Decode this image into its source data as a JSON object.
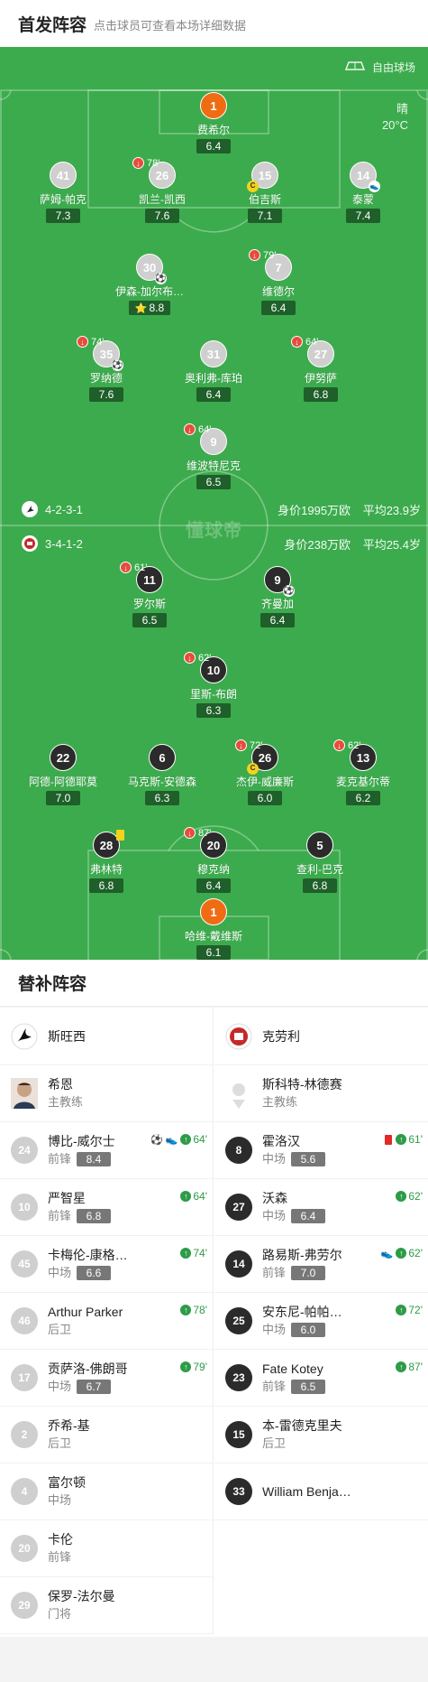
{
  "header": {
    "title": "首发阵容",
    "subtitle": "点击球员可查看本场详细数据"
  },
  "pitch": {
    "free_label": "自由球场",
    "weather": "晴",
    "temperature": "20°C",
    "watermark": "懂球帝",
    "home": {
      "formation": "4-2-3-1",
      "value": "身价1995万欧",
      "age": "平均23.9岁"
    },
    "away": {
      "formation": "3-4-1-2",
      "value": "身价238万欧",
      "age": "平均25.4岁"
    }
  },
  "home_players": [
    {
      "num": "1",
      "name": "费希尔",
      "rating": "6.4",
      "gk": true
    },
    {
      "num": "41",
      "name": "萨姆-帕克",
      "rating": "7.3"
    },
    {
      "num": "26",
      "name": "凯兰-凯西",
      "rating": "7.6",
      "sub": "78'"
    },
    {
      "num": "15",
      "name": "伯吉斯",
      "rating": "7.1",
      "cap": "C"
    },
    {
      "num": "14",
      "name": "泰蒙",
      "rating": "7.4",
      "assist": true
    },
    {
      "num": "30",
      "name": "伊森-加尔布…",
      "rating": "8.8",
      "ball": true,
      "star": true
    },
    {
      "num": "7",
      "name": "维德尔",
      "rating": "6.4",
      "sub": "79'"
    },
    {
      "num": "35",
      "name": "罗纳德",
      "rating": "7.6",
      "sub": "74'",
      "ball": true
    },
    {
      "num": "31",
      "name": "奥利弗-库珀",
      "rating": "6.4"
    },
    {
      "num": "27",
      "name": "伊努萨",
      "rating": "6.8",
      "sub": "64'"
    },
    {
      "num": "9",
      "name": "维波特尼克",
      "rating": "6.5",
      "sub": "64'"
    }
  ],
  "away_players": [
    {
      "num": "11",
      "name": "罗尔斯",
      "rating": "6.5",
      "sub": "61'"
    },
    {
      "num": "9",
      "name": "齐曼加",
      "rating": "6.4",
      "ball": true
    },
    {
      "num": "10",
      "name": "里斯-布朗",
      "rating": "6.3",
      "sub": "62'"
    },
    {
      "num": "22",
      "name": "阿德-阿德耶莫",
      "rating": "7.0"
    },
    {
      "num": "6",
      "name": "马克斯-安德森",
      "rating": "6.3"
    },
    {
      "num": "26",
      "name": "杰伊-威廉斯",
      "rating": "6.0",
      "sub": "72'",
      "cap": "C"
    },
    {
      "num": "13",
      "name": "麦克基尔蒂",
      "rating": "6.2",
      "sub": "62'"
    },
    {
      "num": "28",
      "name": "弗林特",
      "rating": "6.8",
      "yellow": true
    },
    {
      "num": "20",
      "name": "穆克纳",
      "rating": "6.4",
      "sub": "87'"
    },
    {
      "num": "5",
      "name": "查利-巴克",
      "rating": "6.8"
    },
    {
      "num": "1",
      "name": "哈维-戴维斯",
      "rating": "6.1",
      "gk": true
    }
  ],
  "subs": {
    "title": "替补阵容",
    "home_team": "斯旺西",
    "away_team": "克劳利",
    "home_coach": {
      "name": "希恩",
      "role": "主教练"
    },
    "away_coach": {
      "name": "斯科特-林德赛",
      "role": "主教练"
    },
    "home": [
      {
        "num": "24",
        "name": "博比-威尔士",
        "pos": "前锋",
        "rating": "8.4",
        "time": "64'",
        "goal": true,
        "assist": true
      },
      {
        "num": "10",
        "name": "严智星",
        "pos": "前锋",
        "rating": "6.8",
        "time": "64'"
      },
      {
        "num": "45",
        "name": "卡梅伦-康格…",
        "pos": "中场",
        "rating": "6.6",
        "time": "74'"
      },
      {
        "num": "46",
        "name": "Arthur Parker",
        "pos": "后卫",
        "rating": "",
        "time": "78'"
      },
      {
        "num": "17",
        "name": "贡萨洛-佛朗哥",
        "pos": "中场",
        "rating": "6.7",
        "time": "79'"
      },
      {
        "num": "2",
        "name": "乔希-基",
        "pos": "后卫",
        "rating": ""
      },
      {
        "num": "4",
        "name": "富尔顿",
        "pos": "中场",
        "rating": ""
      },
      {
        "num": "20",
        "name": "卡伦",
        "pos": "前锋",
        "rating": ""
      },
      {
        "num": "29",
        "name": "保罗-法尔曼",
        "pos": "门将",
        "rating": ""
      }
    ],
    "away": [
      {
        "num": "8",
        "name": "霍洛汉",
        "pos": "中场",
        "rating": "5.6",
        "time": "61'",
        "red": true
      },
      {
        "num": "27",
        "name": "沃森",
        "pos": "中场",
        "rating": "6.4",
        "time": "62'"
      },
      {
        "num": "14",
        "name": "路易斯-弗劳尔",
        "pos": "前锋",
        "rating": "7.0",
        "time": "62'",
        "assist": true
      },
      {
        "num": "25",
        "name": "安东尼-帕帕…",
        "pos": "中场",
        "rating": "6.0",
        "time": "72'"
      },
      {
        "num": "23",
        "name": "Fate Kotey",
        "pos": "前锋",
        "rating": "6.5",
        "time": "87'"
      },
      {
        "num": "15",
        "name": "本-雷德克里夫",
        "pos": "后卫",
        "rating": ""
      },
      {
        "num": "33",
        "name": "William Benja…",
        "pos": "",
        "rating": ""
      }
    ]
  }
}
